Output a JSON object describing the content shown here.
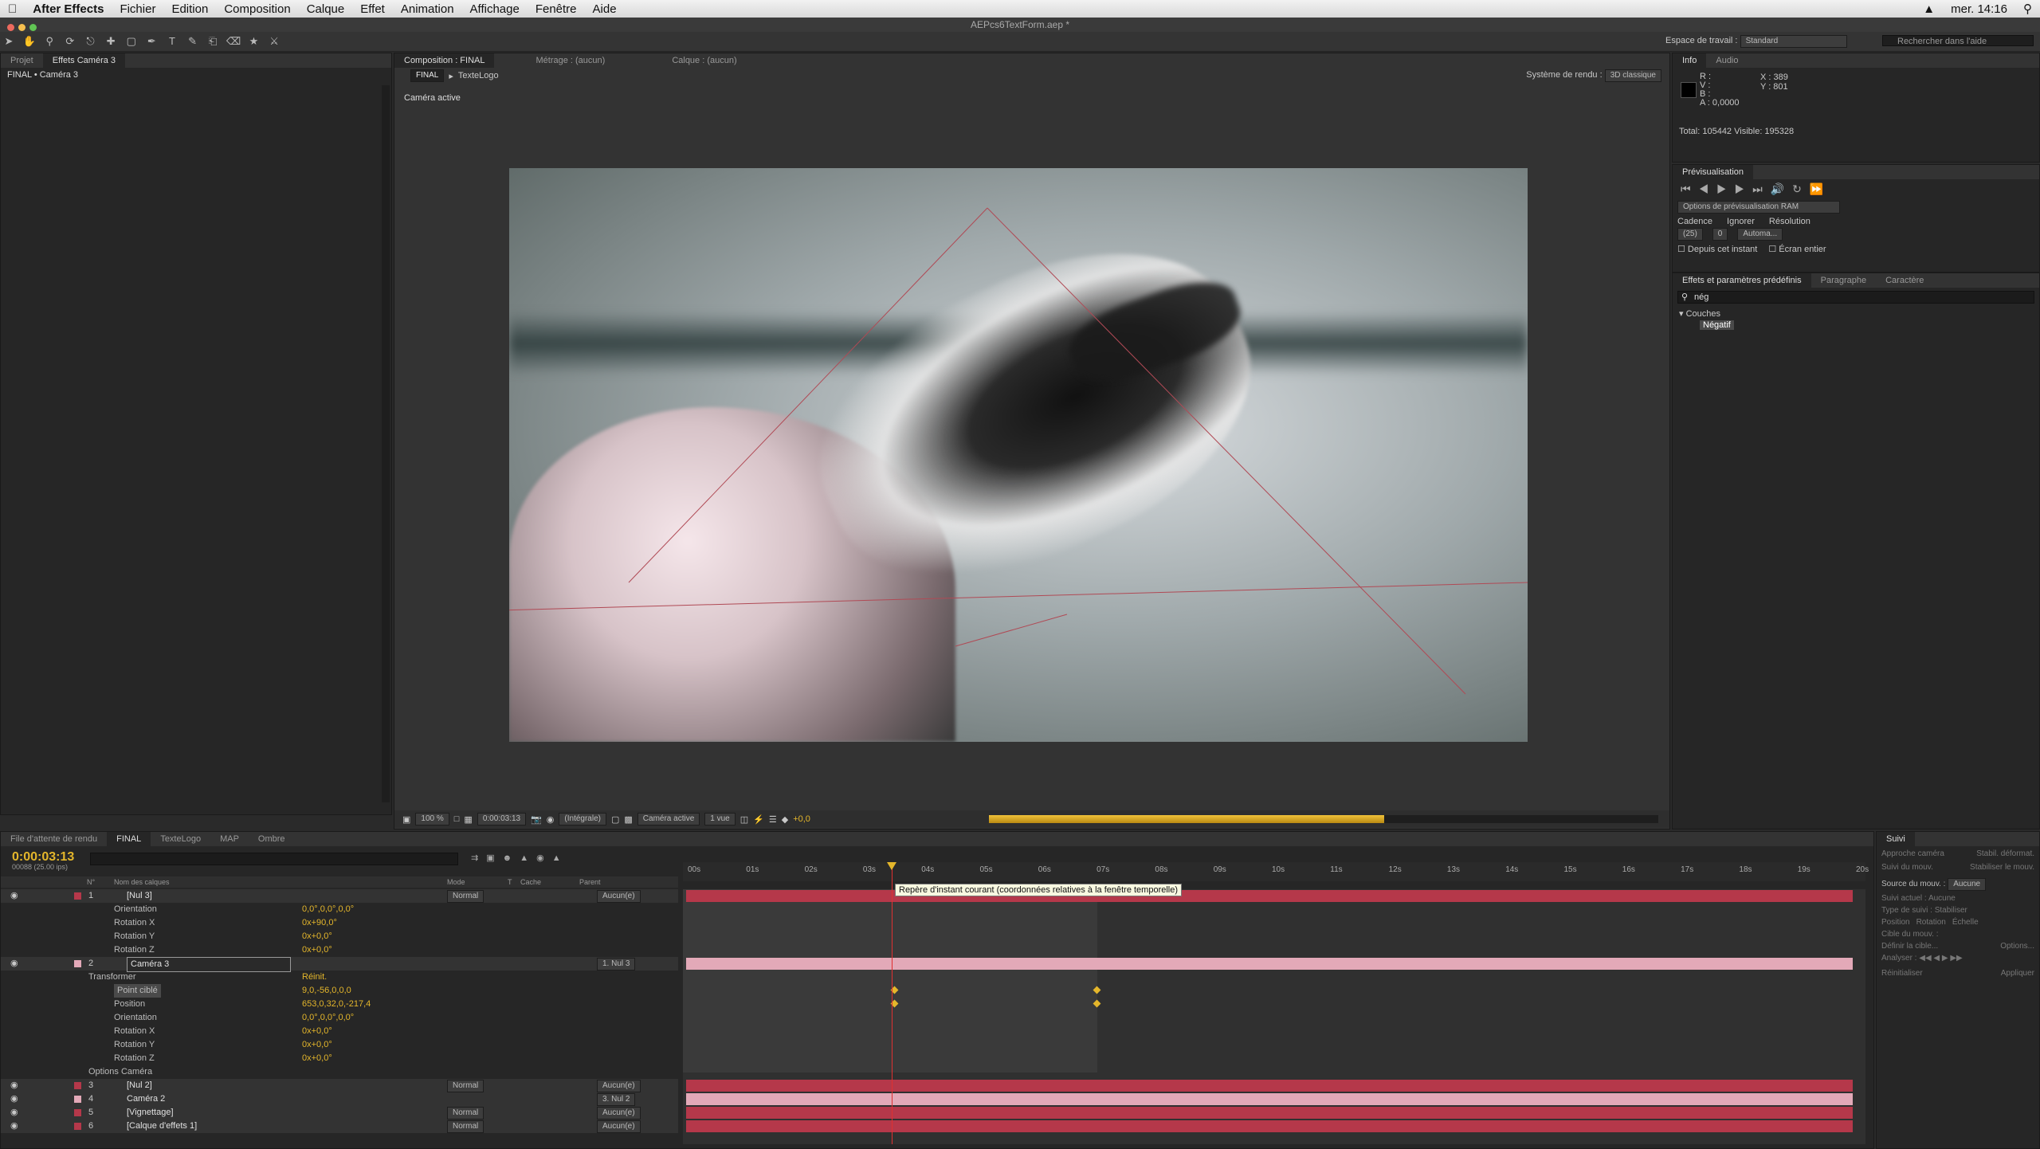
{
  "menubar": {
    "apple": "",
    "app": "After Effects",
    "items": [
      "Fichier",
      "Edition",
      "Composition",
      "Calque",
      "Effet",
      "Animation",
      "Affichage",
      "Fenêtre",
      "Aide"
    ],
    "clock": "mer. 14:16"
  },
  "window": {
    "title": "AEPcs6TextForm.aep *"
  },
  "workspace": {
    "label": "Espace de travail :",
    "value": "Standard",
    "search_placeholder": "Rechercher dans l'aide"
  },
  "left_panel": {
    "tabs": [
      "Projet",
      "Effets Caméra 3"
    ],
    "header": "FINAL • Caméra 3"
  },
  "comp_panel": {
    "tabs": [
      "Composition : FINAL",
      "Métrage : (aucun)",
      "Calque : (aucun)"
    ],
    "breadcrumbs": [
      "FINAL",
      "TexteLogo"
    ],
    "renderer_label": "Système de rendu :",
    "renderer_value": "3D classique",
    "view_label": "Caméra active",
    "footer": {
      "zoom": "100 %",
      "time": "0:00:03:13",
      "res": "(Intégrale)",
      "camera": "Caméra active",
      "views": "1 vue",
      "exposure": "+0,0"
    }
  },
  "info_panel": {
    "tabs": [
      "Info",
      "Audio"
    ],
    "r": "R :",
    "v": "V :",
    "b": "B :",
    "a": "A : 0,0000",
    "x": "X : 389",
    "y": "Y : 801",
    "totals": "Total: 105442   Visible: 195328"
  },
  "preview_panel": {
    "title": "Prévisualisation",
    "ram": "Options de prévisualisation RAM",
    "cadence_label": "Cadence",
    "ignore_label": "Ignorer",
    "resolution_label": "Résolution",
    "cadence": "(25)",
    "ignore": "0",
    "resolution": "Automa...",
    "from_now": "Depuis cet instant",
    "fullscreen": "Écran entier"
  },
  "effects_panel": {
    "tabs": [
      "Effets et paramètres prédéfinis",
      "Paragraphe",
      "Caractère"
    ],
    "search": "nég",
    "category": "Couches",
    "item": "Négatif"
  },
  "timeline": {
    "tabs": [
      "File d'attente de rendu",
      "FINAL",
      "TexteLogo",
      "MAP",
      "Ombre"
    ],
    "timecode": "0:00:03:13",
    "frames": "00088 (25.00 ips)",
    "col_headers": {
      "num": "N°",
      "name": "Nom des calques",
      "mode": "Mode",
      "t": "T",
      "cache": "Cache",
      "parent": "Parent"
    },
    "ruler": [
      "00s",
      "01s",
      "02s",
      "03s",
      "04s",
      "05s",
      "06s",
      "07s",
      "08s",
      "09s",
      "10s",
      "11s",
      "12s",
      "13s",
      "14s",
      "15s",
      "16s",
      "17s",
      "18s",
      "19s",
      "20s"
    ],
    "tooltip": "Repère d'instant courant (coordonnées relatives à la fenêtre temporelle)",
    "rows": [
      {
        "num": "1",
        "name": "[Nul 3]",
        "mode": "Normal",
        "parent": "Aucun(e)",
        "kind": "layer"
      },
      {
        "name": "Orientation",
        "value": "0,0°,0,0°,0,0°",
        "kind": "prop"
      },
      {
        "name": "Rotation X",
        "value": "0x+90,0°",
        "kind": "prop"
      },
      {
        "name": "Rotation Y",
        "value": "0x+0,0°",
        "kind": "prop"
      },
      {
        "name": "Rotation Z",
        "value": "0x+0,0°",
        "kind": "prop"
      },
      {
        "num": "2",
        "name": "Caméra 3",
        "parent": "1. Nul 3",
        "kind": "layer"
      },
      {
        "name": "Transformer",
        "value": "Réinit.",
        "kind": "group"
      },
      {
        "name": "Point ciblé",
        "value": "9,0,-56,0,0,0",
        "kind": "prop"
      },
      {
        "name": "Position",
        "value": "653,0,32,0,-217,4",
        "kind": "prop"
      },
      {
        "name": "Orientation",
        "value": "0,0°,0,0°,0,0°",
        "kind": "prop"
      },
      {
        "name": "Rotation X",
        "value": "0x+0,0°",
        "kind": "prop"
      },
      {
        "name": "Rotation Y",
        "value": "0x+0,0°",
        "kind": "prop"
      },
      {
        "name": "Rotation Z",
        "value": "0x+0,0°",
        "kind": "prop"
      },
      {
        "name": "Options Caméra",
        "kind": "group"
      },
      {
        "num": "3",
        "name": "[Nul 2]",
        "mode": "Normal",
        "parent": "Aucun(e)",
        "kind": "layer"
      },
      {
        "num": "4",
        "name": "Caméra 2",
        "parent": "3. Nul 2",
        "kind": "layer"
      },
      {
        "num": "5",
        "name": "[Vignettage]",
        "mode": "Normal",
        "parent": "Aucun(e)",
        "kind": "layer"
      },
      {
        "num": "6",
        "name": "[Calque d'effets 1]",
        "mode": "Normal",
        "parent": "Aucun(e)",
        "kind": "layer"
      }
    ]
  },
  "tracker_panel": {
    "title": "Suivi",
    "btn1": "Approche caméra",
    "btn2": "Stabil. déformat.",
    "btn3": "Suivi du mouv.",
    "btn4": "Stabiliser le mouv.",
    "source_label": "Source du mouv. :",
    "source": "Aucune",
    "current_label": "Suivi actuel :",
    "current": "Aucune",
    "type_label": "Type de suivi :",
    "type": "Stabiliser",
    "position": "Position",
    "rotation": "Rotation",
    "scale": "Échelle",
    "target_label": "Cible du mouv. :",
    "define": "Définir la cible...",
    "options": "Options...",
    "analyse": "Analyser :",
    "reset": "Réinitialiser",
    "apply": "Appliquer"
  },
  "colors": {
    "accent": "#e4b62b",
    "layer_red": "#b5384a",
    "layer_pink": "#e3a9b8"
  }
}
